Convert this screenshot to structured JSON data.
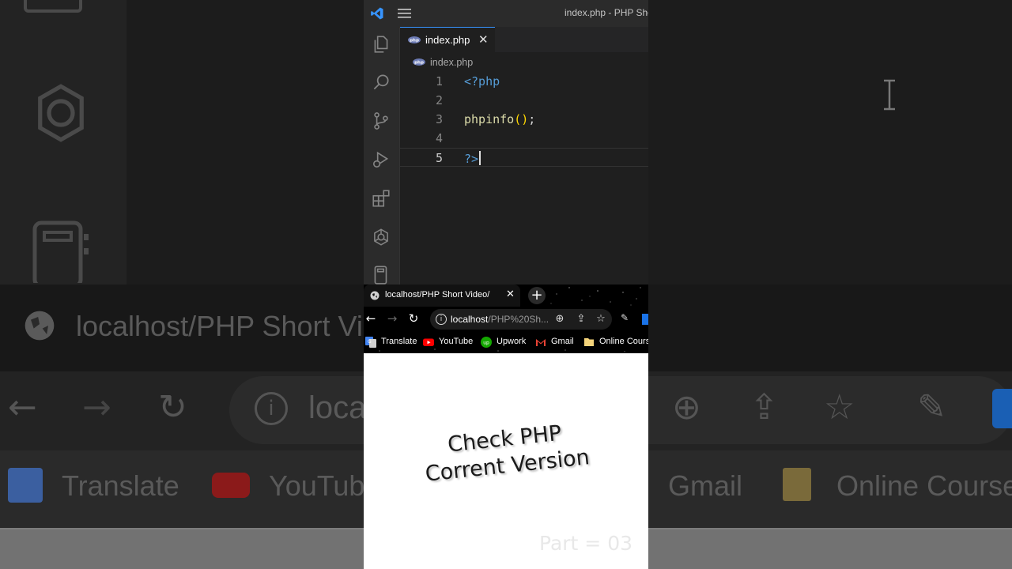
{
  "vscode": {
    "window_title": "index.php - PHP Sho",
    "tab": {
      "label": "index.php",
      "close": "✕"
    },
    "breadcrumb": "index.php",
    "code_lines": [
      {
        "num": "1",
        "text": "<?php"
      },
      {
        "num": "2",
        "text": ""
      },
      {
        "num": "3",
        "text": "phpinfo();"
      },
      {
        "num": "4",
        "text": ""
      },
      {
        "num": "5",
        "text": "?>"
      }
    ],
    "activity_icons": [
      "explorer-icon",
      "search-icon",
      "source-control-icon",
      "run-debug-icon",
      "extensions-icon",
      "chatgpt-icon",
      "notebook-icon"
    ]
  },
  "browser": {
    "tab_title": "localhost/PHP Short Video/",
    "tab_close": "✕",
    "new_tab": "+",
    "url_host": "localhost",
    "url_path": "/PHP%20Sh...",
    "bookmarks": [
      {
        "label": "Translate",
        "icon": "google-translate-icon",
        "color": "#4285f4"
      },
      {
        "label": "YouTube",
        "icon": "youtube-icon",
        "color": "#ff0000"
      },
      {
        "label": "Upwork",
        "icon": "upwork-icon",
        "color": "#14a800"
      },
      {
        "label": "Gmail",
        "icon": "gmail-icon",
        "color": "#ea4335"
      },
      {
        "label": "Online Course",
        "icon": "folder-icon",
        "color": "#f4d37a"
      }
    ]
  },
  "page": {
    "title_line1": "Check PHP",
    "title_line2": "Corrent Version",
    "part_label": "Part = 03"
  },
  "background": {
    "url_text": "localhost/PHP Short Vi",
    "omnibox_text": "loca",
    "bm_translate": "Translate",
    "bm_youtube": "YouTub",
    "bm_gmail": "Gmail",
    "bm_online": "Online Course"
  },
  "colors": {
    "accent_blue": "#3794ff",
    "php_tag": "#569cd6",
    "function": "#dcdcaa",
    "punct": "#ffd700",
    "editor_bg": "#1f1f1f",
    "activity_bg": "#2b2b2b"
  }
}
